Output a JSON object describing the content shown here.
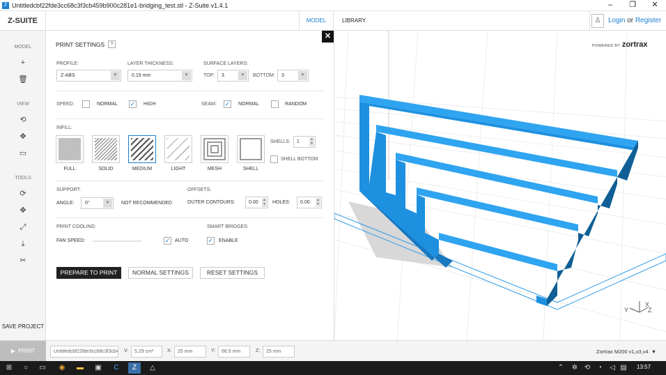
{
  "window": {
    "title": "Untitledcbf22fde3cc68c3f3cb459b900c281e1-bridging_test.stl - Z-Suite v1.4.1",
    "controls": {
      "minimize": "–",
      "maximize": "❐",
      "close": "✕"
    }
  },
  "header": {
    "brand": "Z-SUITE",
    "tabs": [
      {
        "label": "MODEL",
        "active": true
      },
      {
        "label": "LIBRARY",
        "active": false
      }
    ],
    "login": {
      "login_label": "Login",
      "or_label": "or",
      "register_label": "Register"
    },
    "powered_by": "POWERED BY",
    "logo": "zortrax"
  },
  "sidebar": {
    "model_heading": "MODEL",
    "view_heading": "VIEW",
    "tools_heading": "TOOLS",
    "save_project": "SAVE PROJECT",
    "icons": {
      "add": "+",
      "delete": "🗑",
      "rotate_view": "⟲",
      "move_view": "✥",
      "camera": "▭",
      "rotate_tool": "⟳",
      "move_tool": "✥",
      "scale_tool": "⤢",
      "lay_flat": "⤓",
      "cut_tool": "✂"
    }
  },
  "print_settings": {
    "title": "PRINT SETTINGS",
    "help": "?",
    "close": "✕",
    "profile": {
      "label": "PROFILE:",
      "value": "Z-ABS"
    },
    "layer_thickness": {
      "label": "LAYER THICKNESS:",
      "value": "0.19 mm"
    },
    "surface_layers": {
      "label": "SURFACE LAYERS:",
      "top_label": "TOP:",
      "top_value": "3",
      "bottom_label": "BOTTOM:",
      "bottom_value": "3"
    },
    "speed": {
      "label": "SPEED:",
      "normal": "NORMAL",
      "high": "HIGH",
      "selected": "HIGH"
    },
    "seam": {
      "label": "SEAM:",
      "normal": "NORMAL",
      "random": "RANDOM",
      "selected": "NORMAL"
    },
    "infill": {
      "label": "INFILL:",
      "options": [
        "FULL",
        "SOLID",
        "MEDIUM",
        "LIGHT",
        "MESH",
        "SHELL"
      ],
      "selected": "MEDIUM",
      "shells_label": "SHELLS:",
      "shells_value": "1",
      "shell_bottom_label": "SHELL BOTTOM"
    },
    "support": {
      "label": "SUPPORT:",
      "angle_label": "ANGLE:",
      "angle_value": "0°",
      "note": "NOT RECOMMENDED"
    },
    "offsets": {
      "label": "OFFSETS:",
      "outer_label": "OUTER CONTOURS:",
      "outer_value": "0.00",
      "holes_label": "HOLES:",
      "holes_value": "0.00"
    },
    "print_cooling": {
      "label": "PRINT COOLING:",
      "fan_label": "FAN SPEED:",
      "auto_label": "AUTO"
    },
    "smart_bridges": {
      "label": "SMART BRIDGES:",
      "enable_label": "ENABLE"
    },
    "buttons": {
      "prepare": "PREPARE TO PRINT",
      "normal": "NORMAL SETTINGS",
      "reset": "RESET SETTINGS"
    }
  },
  "statusbar": {
    "print_label": "PRINT",
    "filename": "Untitledcbf22fde3cc68c3f3cb459b900c281e1-bridging_test.stl",
    "v_label": "V:",
    "v_value": "5.29 cm³",
    "x_label": "X:",
    "x_value": "25 mm",
    "y_label": "Y:",
    "y_value": "66.5 mm",
    "z_label": "Z:",
    "z_value": "25 mm",
    "printer": "Zortrax M200 v1,v3,v4"
  },
  "viewport": {
    "axes": {
      "y": "Y",
      "x": "X",
      "z": "Z"
    }
  },
  "taskbar": {
    "clock": "13:57"
  },
  "colors": {
    "accent": "#1c7fd0",
    "model": "#1e90e0",
    "model_shade": "#0f5f96"
  }
}
